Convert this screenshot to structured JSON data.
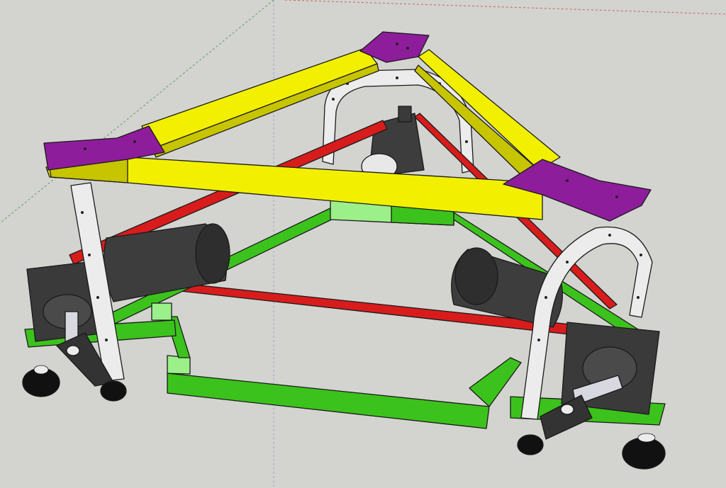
{
  "viewport": {
    "background_color": "#d3d3d0",
    "axis_colors": {
      "red": "#c86464",
      "green": "#5fa05f",
      "blue": "#8080d0"
    }
  },
  "model": {
    "parts": [
      {
        "name": "top-triangle-frame",
        "color": "#f2f000",
        "shade": "#c7c400"
      },
      {
        "name": "corner-gusset-plates",
        "color": "#8e1d9b"
      },
      {
        "name": "diagonal-cross-braces",
        "color": "#d81c1c"
      },
      {
        "name": "base-frame",
        "color": "#3cc21c",
        "light": "#9cf08a"
      },
      {
        "name": "drive-motors",
        "color": "#3d3d3d"
      },
      {
        "name": "gearboxes",
        "color": "#3a3a3a"
      },
      {
        "name": "hanger-brackets",
        "color": "#ececec"
      },
      {
        "name": "omni-wheels",
        "color": "#111111"
      }
    ]
  }
}
